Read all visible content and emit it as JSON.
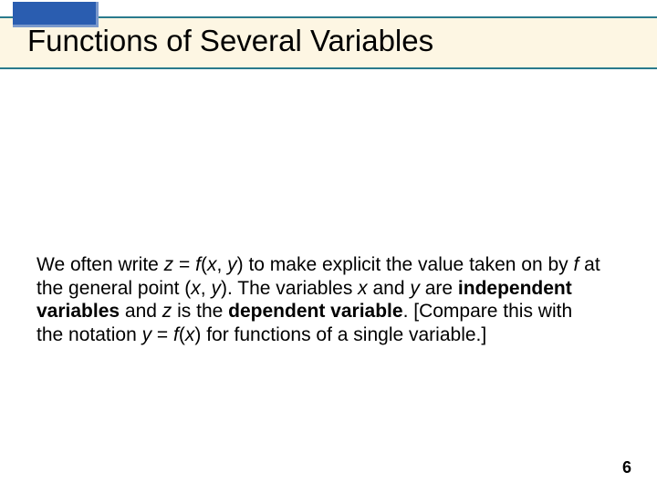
{
  "title": "Functions of Several Variables",
  "body": {
    "t1": "We often write ",
    "z": "z",
    "eq": " = ",
    "f1": "f",
    "paren1": "(",
    "x1": "x",
    "comma1": ", ",
    "y1": "y",
    "paren2": ") to make explicit the value taken on by ",
    "f2": "f",
    "t2": " at the general point (",
    "x2": "x",
    "comma2": ", ",
    "y2": "y",
    "t3": "). The variables ",
    "x3": "x",
    "t4": " and ",
    "y3": "y",
    "t5": " are ",
    "b1": "independent variables",
    "t6": " and ",
    "z2": "z",
    "t7": " is the ",
    "b2": "dependent variable",
    "t8": ". [Compare this with the notation ",
    "y4": "y",
    "eq2": " = ",
    "f3": "f",
    "paren3": "(",
    "x4": "x",
    "paren4": ") for functions of a single variable.]"
  },
  "page": "6"
}
